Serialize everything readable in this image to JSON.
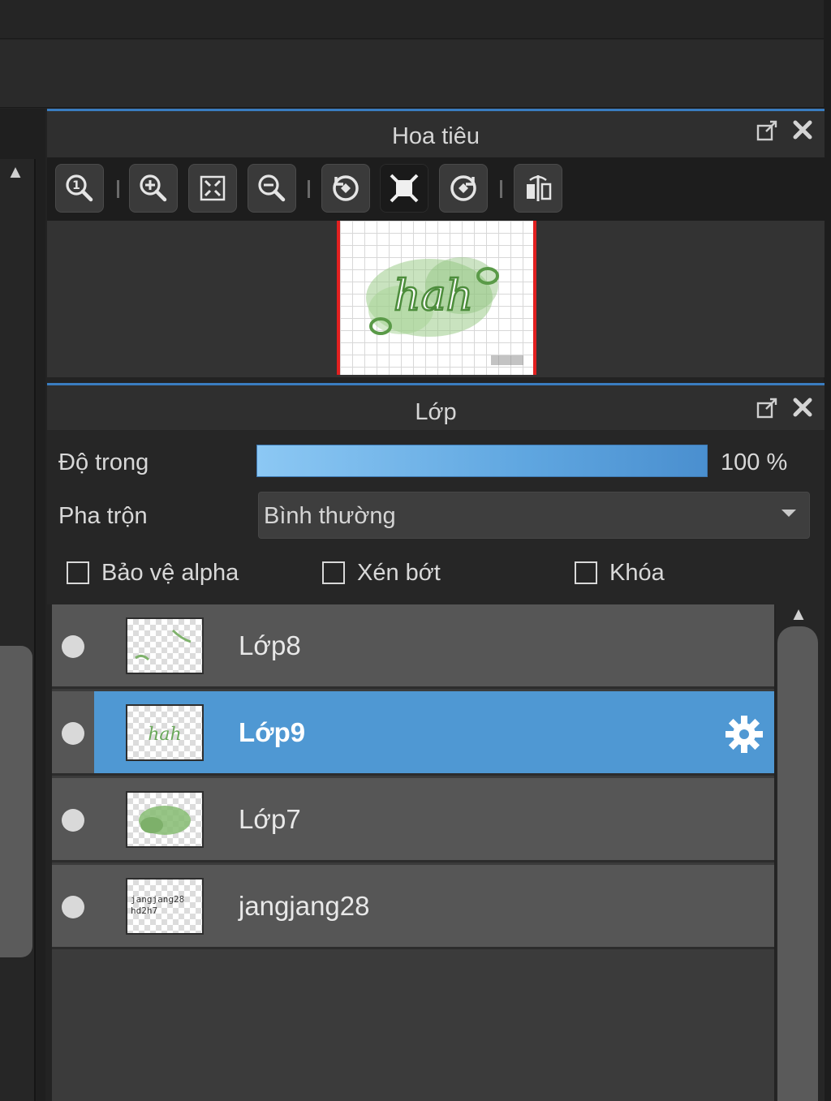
{
  "navigator": {
    "title": "Hoa tiêu",
    "header_icons": [
      "popout-icon",
      "close-icon"
    ],
    "tools": [
      {
        "name": "zoom-actual-icon"
      },
      {
        "name": "zoom-in-icon"
      },
      {
        "name": "fit-screen-icon"
      },
      {
        "name": "zoom-out-icon"
      },
      {
        "name": "rotate-left-icon"
      },
      {
        "name": "reset-view-icon",
        "active": true
      },
      {
        "name": "rotate-right-icon"
      },
      {
        "name": "flip-horizontal-icon"
      }
    ],
    "preview_text": "hah"
  },
  "layers": {
    "title": "Lớp",
    "opacity_label": "Độ trong",
    "opacity_value": "100 %",
    "opacity_percent": 100,
    "blend_label": "Pha trộn",
    "blend_value": "Bình thường",
    "checkboxes": {
      "protect_alpha": "Bảo vệ alpha",
      "clipping": "Xén bớt",
      "lock": "Khóa"
    },
    "items": [
      {
        "name": "Lớp8",
        "selected": false,
        "visible": true
      },
      {
        "name": "Lớp9",
        "selected": true,
        "visible": true
      },
      {
        "name": "Lớp7",
        "selected": false,
        "visible": true
      },
      {
        "name": "jangjang28",
        "selected": false,
        "visible": true
      }
    ],
    "thumb_text_1": "jangjang28",
    "thumb_text_2": "hd2h7",
    "thumb_hah": "hah"
  },
  "colors": {
    "accent": "#3a7dc0",
    "selected_row": "#4f98d3",
    "frame_red": "#e22020"
  }
}
